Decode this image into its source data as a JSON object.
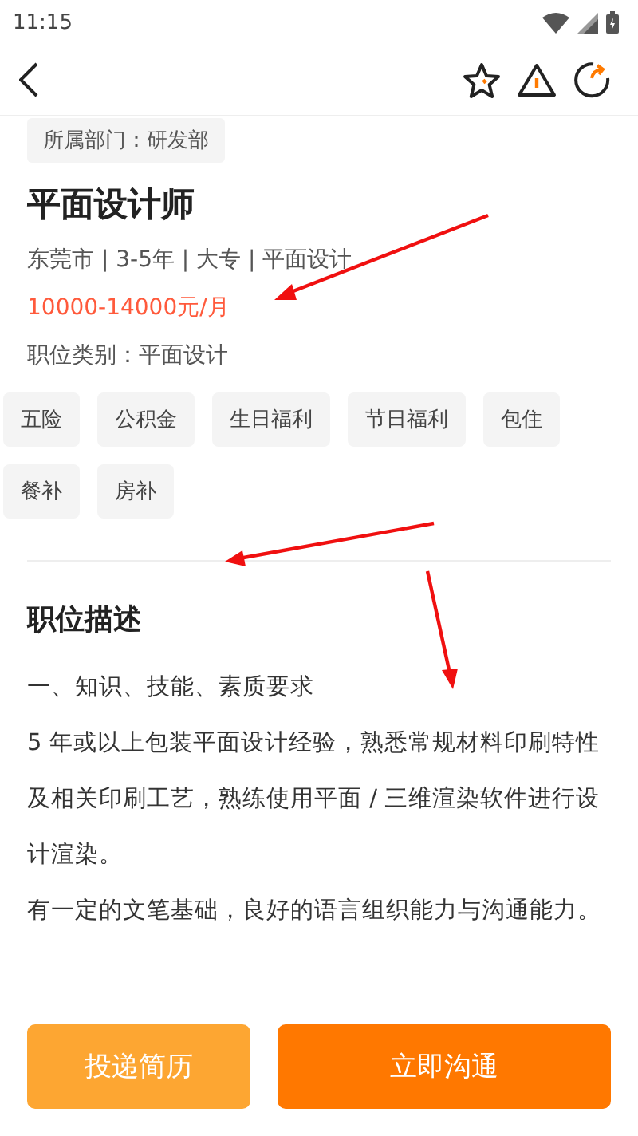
{
  "status_bar": {
    "time": "11:15"
  },
  "job": {
    "department": "所属部门：研发部",
    "title": "平面设计师",
    "meta": "东莞市 | 3-5年 | 大专 | 平面设计",
    "salary": "10000-14000元/月",
    "category": "职位类别：平面设计"
  },
  "benefits": [
    "五险",
    "公积金",
    "生日福利",
    "节日福利",
    "包住",
    "餐补",
    "房补"
  ],
  "description": {
    "heading": "职位描述",
    "paragraphs": [
      "一、知识、技能、素质要求",
      "5 年或以上包装平面设计经验，熟悉常规材料印刷特性及相关印刷工艺，熟练使用平面 / 三维渲染软件进行设计渲染。",
      "有一定的文笔基础，良好的语言组织能力与沟通能力。"
    ]
  },
  "buttons": [
    {
      "label": "投递简历",
      "kind": "secondary"
    },
    {
      "label": "立即沟通",
      "kind": "primary"
    }
  ]
}
